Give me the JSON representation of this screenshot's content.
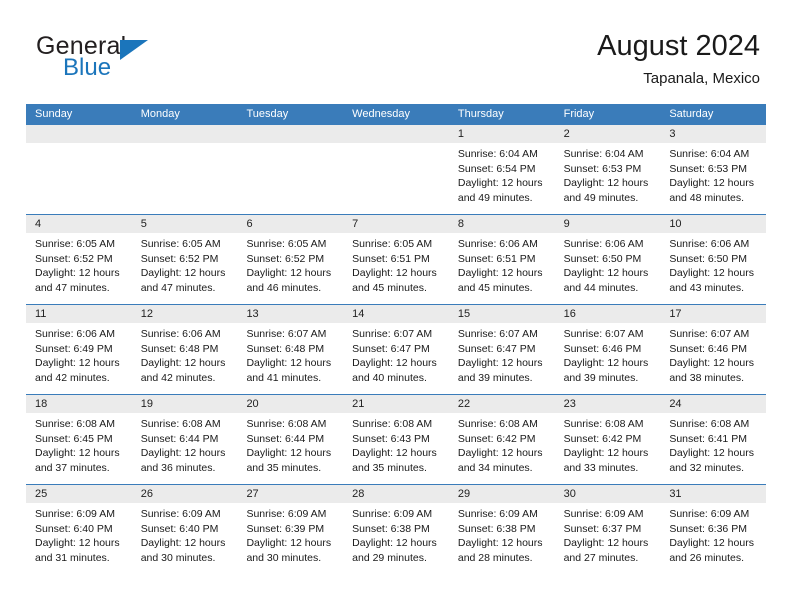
{
  "brand": {
    "name_top": "General",
    "name_bottom": "Blue",
    "logo_icon": "triangle-logo-icon",
    "accent_color": "#1b75bb"
  },
  "header": {
    "title": "August 2024",
    "subtitle": "Tapanala, Mexico"
  },
  "theme": {
    "header_bar_color": "#3a7cba",
    "day_band_color": "#ebebeb",
    "text_color": "#1a1a1a"
  },
  "weekdays": [
    "Sunday",
    "Monday",
    "Tuesday",
    "Wednesday",
    "Thursday",
    "Friday",
    "Saturday"
  ],
  "weeks": [
    [
      {
        "day": "",
        "empty": true,
        "lines": []
      },
      {
        "day": "",
        "empty": true,
        "lines": []
      },
      {
        "day": "",
        "empty": true,
        "lines": []
      },
      {
        "day": "",
        "empty": true,
        "lines": []
      },
      {
        "day": "1",
        "empty": false,
        "lines": [
          "Sunrise: 6:04 AM",
          "Sunset: 6:54 PM",
          "Daylight: 12 hours",
          "and 49 minutes."
        ]
      },
      {
        "day": "2",
        "empty": false,
        "lines": [
          "Sunrise: 6:04 AM",
          "Sunset: 6:53 PM",
          "Daylight: 12 hours",
          "and 49 minutes."
        ]
      },
      {
        "day": "3",
        "empty": false,
        "lines": [
          "Sunrise: 6:04 AM",
          "Sunset: 6:53 PM",
          "Daylight: 12 hours",
          "and 48 minutes."
        ]
      }
    ],
    [
      {
        "day": "4",
        "empty": false,
        "lines": [
          "Sunrise: 6:05 AM",
          "Sunset: 6:52 PM",
          "Daylight: 12 hours",
          "and 47 minutes."
        ]
      },
      {
        "day": "5",
        "empty": false,
        "lines": [
          "Sunrise: 6:05 AM",
          "Sunset: 6:52 PM",
          "Daylight: 12 hours",
          "and 47 minutes."
        ]
      },
      {
        "day": "6",
        "empty": false,
        "lines": [
          "Sunrise: 6:05 AM",
          "Sunset: 6:52 PM",
          "Daylight: 12 hours",
          "and 46 minutes."
        ]
      },
      {
        "day": "7",
        "empty": false,
        "lines": [
          "Sunrise: 6:05 AM",
          "Sunset: 6:51 PM",
          "Daylight: 12 hours",
          "and 45 minutes."
        ]
      },
      {
        "day": "8",
        "empty": false,
        "lines": [
          "Sunrise: 6:06 AM",
          "Sunset: 6:51 PM",
          "Daylight: 12 hours",
          "and 45 minutes."
        ]
      },
      {
        "day": "9",
        "empty": false,
        "lines": [
          "Sunrise: 6:06 AM",
          "Sunset: 6:50 PM",
          "Daylight: 12 hours",
          "and 44 minutes."
        ]
      },
      {
        "day": "10",
        "empty": false,
        "lines": [
          "Sunrise: 6:06 AM",
          "Sunset: 6:50 PM",
          "Daylight: 12 hours",
          "and 43 minutes."
        ]
      }
    ],
    [
      {
        "day": "11",
        "empty": false,
        "lines": [
          "Sunrise: 6:06 AM",
          "Sunset: 6:49 PM",
          "Daylight: 12 hours",
          "and 42 minutes."
        ]
      },
      {
        "day": "12",
        "empty": false,
        "lines": [
          "Sunrise: 6:06 AM",
          "Sunset: 6:48 PM",
          "Daylight: 12 hours",
          "and 42 minutes."
        ]
      },
      {
        "day": "13",
        "empty": false,
        "lines": [
          "Sunrise: 6:07 AM",
          "Sunset: 6:48 PM",
          "Daylight: 12 hours",
          "and 41 minutes."
        ]
      },
      {
        "day": "14",
        "empty": false,
        "lines": [
          "Sunrise: 6:07 AM",
          "Sunset: 6:47 PM",
          "Daylight: 12 hours",
          "and 40 minutes."
        ]
      },
      {
        "day": "15",
        "empty": false,
        "lines": [
          "Sunrise: 6:07 AM",
          "Sunset: 6:47 PM",
          "Daylight: 12 hours",
          "and 39 minutes."
        ]
      },
      {
        "day": "16",
        "empty": false,
        "lines": [
          "Sunrise: 6:07 AM",
          "Sunset: 6:46 PM",
          "Daylight: 12 hours",
          "and 39 minutes."
        ]
      },
      {
        "day": "17",
        "empty": false,
        "lines": [
          "Sunrise: 6:07 AM",
          "Sunset: 6:46 PM",
          "Daylight: 12 hours",
          "and 38 minutes."
        ]
      }
    ],
    [
      {
        "day": "18",
        "empty": false,
        "lines": [
          "Sunrise: 6:08 AM",
          "Sunset: 6:45 PM",
          "Daylight: 12 hours",
          "and 37 minutes."
        ]
      },
      {
        "day": "19",
        "empty": false,
        "lines": [
          "Sunrise: 6:08 AM",
          "Sunset: 6:44 PM",
          "Daylight: 12 hours",
          "and 36 minutes."
        ]
      },
      {
        "day": "20",
        "empty": false,
        "lines": [
          "Sunrise: 6:08 AM",
          "Sunset: 6:44 PM",
          "Daylight: 12 hours",
          "and 35 minutes."
        ]
      },
      {
        "day": "21",
        "empty": false,
        "lines": [
          "Sunrise: 6:08 AM",
          "Sunset: 6:43 PM",
          "Daylight: 12 hours",
          "and 35 minutes."
        ]
      },
      {
        "day": "22",
        "empty": false,
        "lines": [
          "Sunrise: 6:08 AM",
          "Sunset: 6:42 PM",
          "Daylight: 12 hours",
          "and 34 minutes."
        ]
      },
      {
        "day": "23",
        "empty": false,
        "lines": [
          "Sunrise: 6:08 AM",
          "Sunset: 6:42 PM",
          "Daylight: 12 hours",
          "and 33 minutes."
        ]
      },
      {
        "day": "24",
        "empty": false,
        "lines": [
          "Sunrise: 6:08 AM",
          "Sunset: 6:41 PM",
          "Daylight: 12 hours",
          "and 32 minutes."
        ]
      }
    ],
    [
      {
        "day": "25",
        "empty": false,
        "lines": [
          "Sunrise: 6:09 AM",
          "Sunset: 6:40 PM",
          "Daylight: 12 hours",
          "and 31 minutes."
        ]
      },
      {
        "day": "26",
        "empty": false,
        "lines": [
          "Sunrise: 6:09 AM",
          "Sunset: 6:40 PM",
          "Daylight: 12 hours",
          "and 30 minutes."
        ]
      },
      {
        "day": "27",
        "empty": false,
        "lines": [
          "Sunrise: 6:09 AM",
          "Sunset: 6:39 PM",
          "Daylight: 12 hours",
          "and 30 minutes."
        ]
      },
      {
        "day": "28",
        "empty": false,
        "lines": [
          "Sunrise: 6:09 AM",
          "Sunset: 6:38 PM",
          "Daylight: 12 hours",
          "and 29 minutes."
        ]
      },
      {
        "day": "29",
        "empty": false,
        "lines": [
          "Sunrise: 6:09 AM",
          "Sunset: 6:38 PM",
          "Daylight: 12 hours",
          "and 28 minutes."
        ]
      },
      {
        "day": "30",
        "empty": false,
        "lines": [
          "Sunrise: 6:09 AM",
          "Sunset: 6:37 PM",
          "Daylight: 12 hours",
          "and 27 minutes."
        ]
      },
      {
        "day": "31",
        "empty": false,
        "lines": [
          "Sunrise: 6:09 AM",
          "Sunset: 6:36 PM",
          "Daylight: 12 hours",
          "and 26 minutes."
        ]
      }
    ]
  ]
}
